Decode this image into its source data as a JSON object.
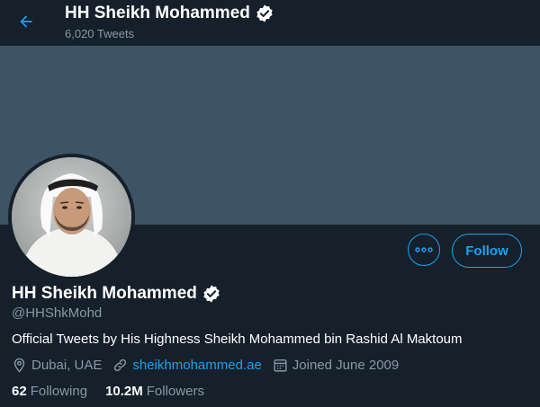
{
  "header": {
    "back_icon": "arrow-left-icon",
    "name": "HH Sheikh Mohammed",
    "verified_icon": "verified-badge-icon",
    "tweet_count": "6,020 Tweets"
  },
  "profile": {
    "name": "HH Sheikh Mohammed",
    "handle": "@HHShkMohd",
    "bio": "Official Tweets by His Highness Sheikh Mohammed bin Rashid Al Maktoum",
    "location": "Dubai, UAE",
    "website": "sheikhmohammed.ae",
    "joined": "Joined June 2009",
    "following_value": "62",
    "following_label": "Following",
    "followers_value": "10.2M",
    "followers_label": "Followers"
  },
  "actions": {
    "more_icon": "more-dots-icon",
    "follow_label": "Follow"
  },
  "colors": {
    "background": "#15202b",
    "banner": "#3d5466",
    "accent": "#1da1f2",
    "muted_text": "#8899a6"
  }
}
